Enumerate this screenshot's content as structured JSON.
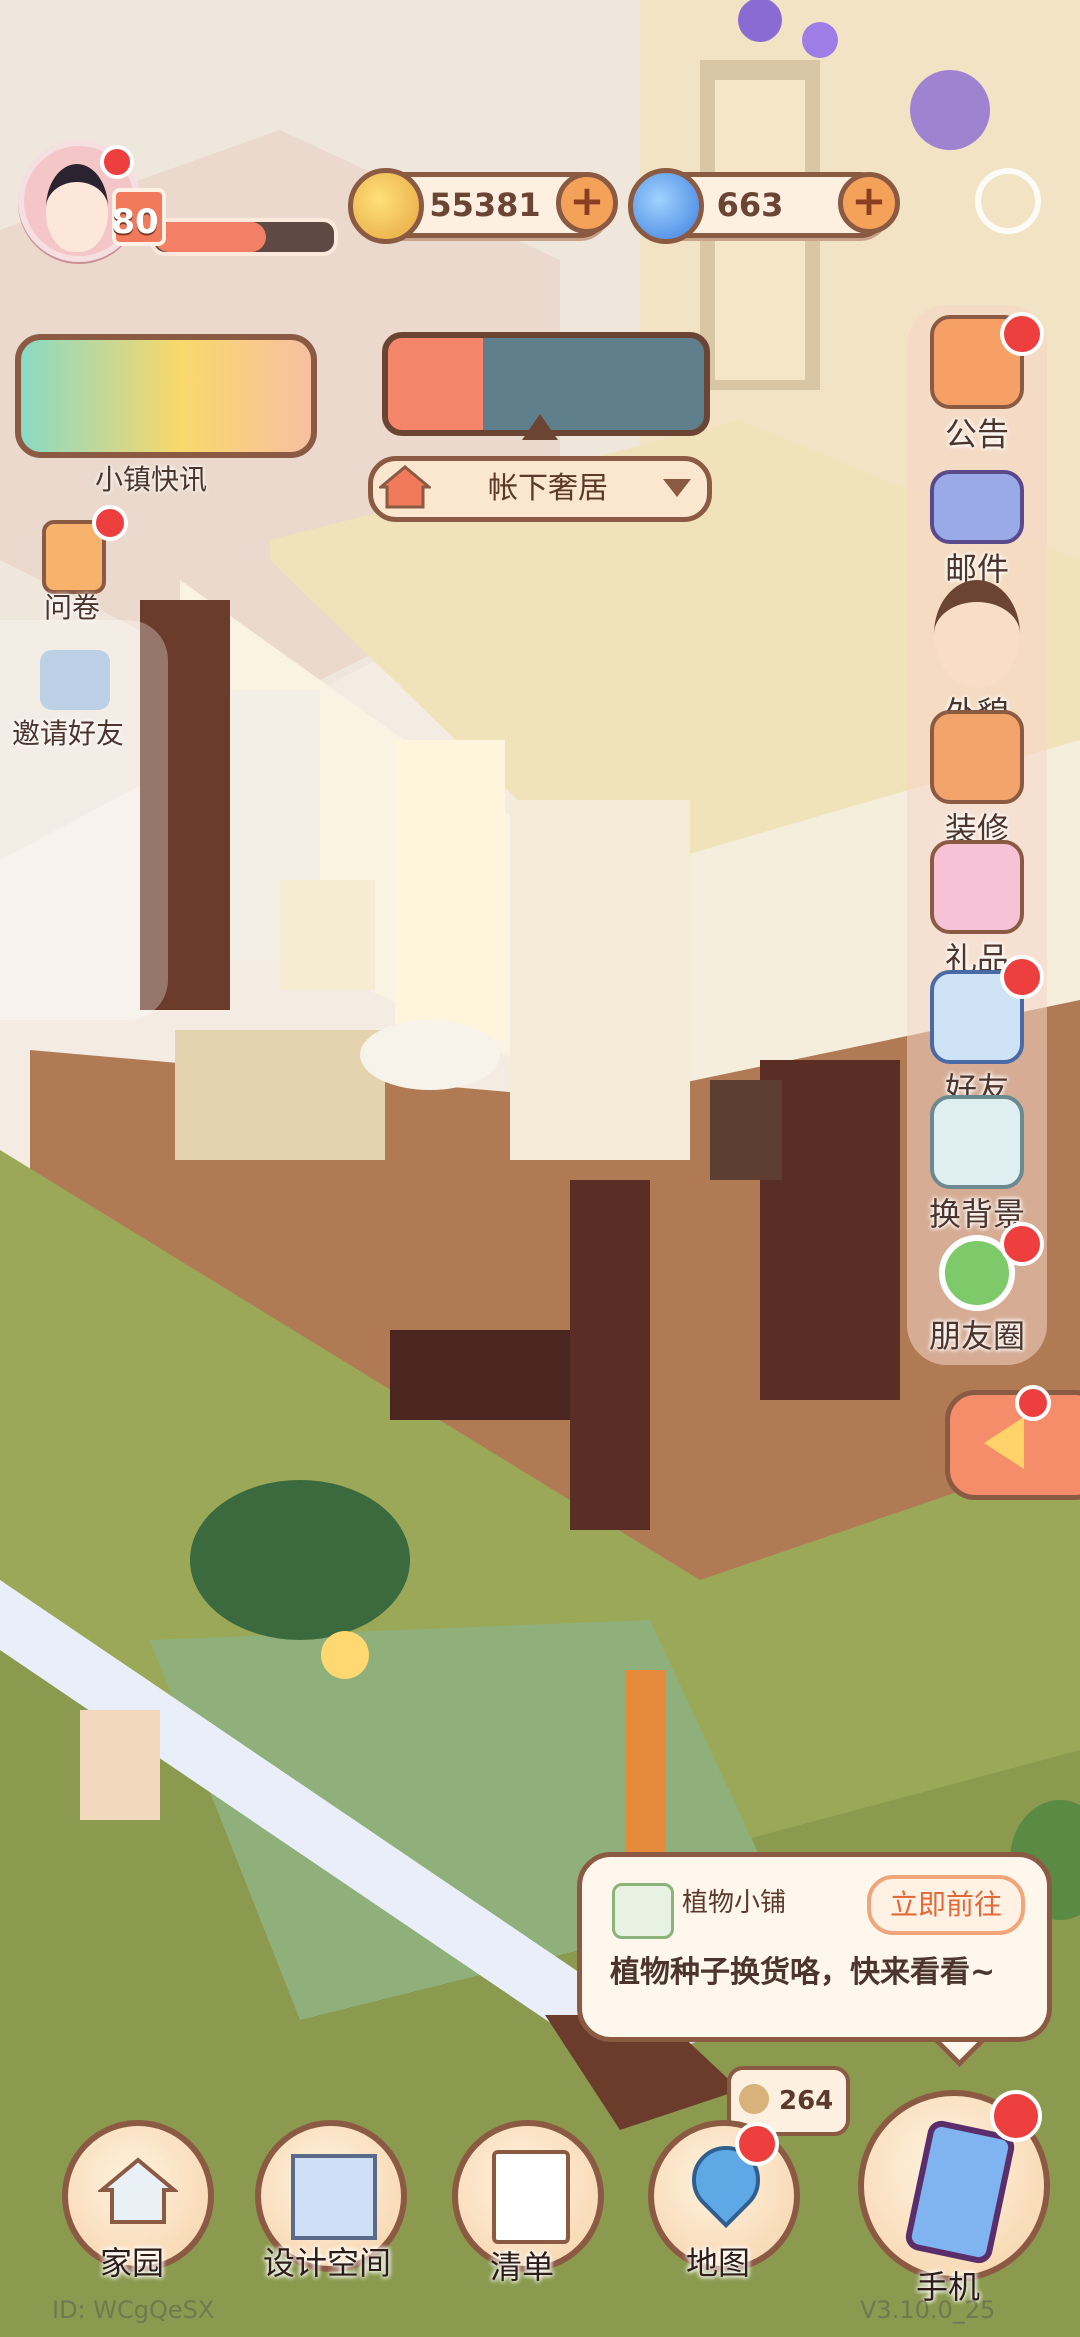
{
  "player": {
    "level": "80",
    "exp_fraction": 0.62
  },
  "currency": {
    "coins": "55381",
    "gems": "663"
  },
  "news": {
    "label": "小镇快讯"
  },
  "house_selector": {
    "label": "帐下奢居"
  },
  "left_menu": {
    "survey": "问卷",
    "invite": "邀请好友"
  },
  "sidebar": {
    "items": [
      {
        "label": "公告",
        "icon": "megaphone-icon",
        "badge": true
      },
      {
        "label": "邮件",
        "icon": "envelope-icon",
        "badge": false
      },
      {
        "label": "外貌",
        "icon": "avatar-icon",
        "badge": false
      },
      {
        "label": "装修",
        "icon": "renovate-icon",
        "badge": false
      },
      {
        "label": "礼品",
        "icon": "gift-icon",
        "badge": false
      },
      {
        "label": "好友",
        "icon": "friends-icon",
        "badge": true
      },
      {
        "label": "换背景",
        "icon": "background-icon",
        "badge": false
      },
      {
        "label": "朋友圈",
        "icon": "moments-icon",
        "badge": true
      }
    ]
  },
  "notice": {
    "title": "植物小铺",
    "action": "立即前往",
    "message": "植物种子换货咯，快来看看~"
  },
  "small_coin": {
    "value": "264"
  },
  "bottom_nav": {
    "items": [
      {
        "label": "家园",
        "icon": "home-icon"
      },
      {
        "label": "设计空间",
        "icon": "design-icon"
      },
      {
        "label": "清单",
        "icon": "checklist-icon"
      },
      {
        "label": "地图",
        "icon": "map-pin-icon"
      },
      {
        "label": "手机",
        "icon": "phone-icon"
      }
    ]
  },
  "footer": {
    "id_text": "ID:        WCgQeSX",
    "version": "V3.10.0_25"
  },
  "colors": {
    "brand_brown": "#8b5a43",
    "badge_red": "#ee3f3f",
    "accent_orange": "#f4a25a"
  }
}
